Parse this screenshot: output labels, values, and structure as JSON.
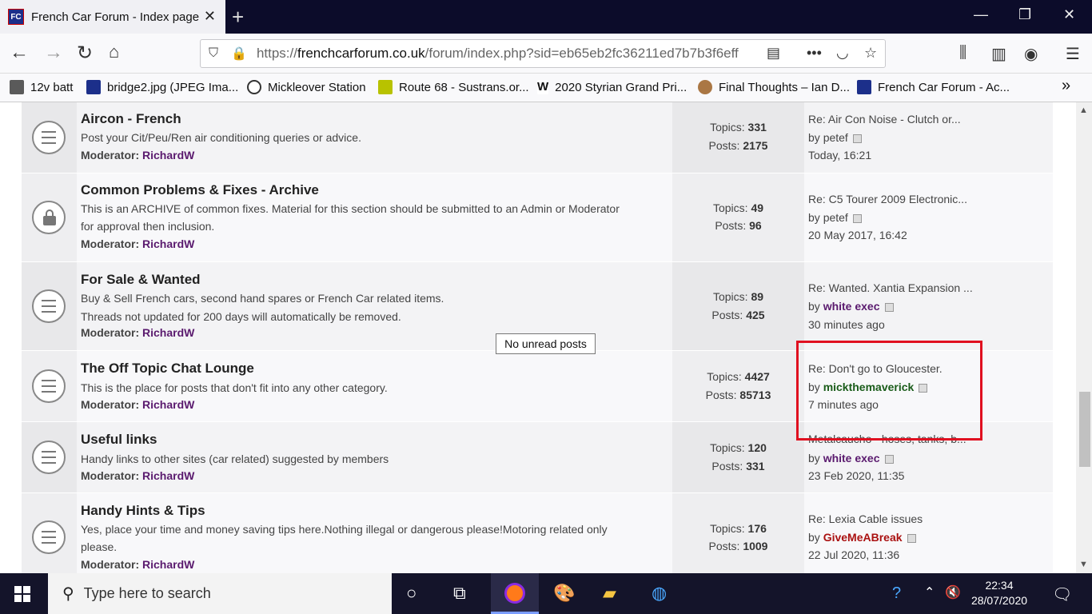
{
  "browser": {
    "tab_title": "French Car Forum - Index page",
    "tab_favicon_text": "FC",
    "url_domain": "frenchcarforum.co.uk",
    "url_prefix": "https://",
    "url_suffix": "/forum/index.php?sid=eb65eb2fc36211ed7b7b3f6eff",
    "bookmarks": [
      {
        "label": "12v batt",
        "color": "#5a5a5a"
      },
      {
        "label": "bridge2.jpg (JPEG Ima...",
        "color": "#1c2f8a"
      },
      {
        "label": "Mickleover Station",
        "color": "#333333"
      },
      {
        "label": "Route 68 - Sustrans.or...",
        "color": "#b8c200"
      },
      {
        "label": "2020 Styrian Grand Pri...",
        "color": "#ffffff"
      },
      {
        "label": "Final Thoughts – Ian D...",
        "color": "#aa7744"
      },
      {
        "label": "French Car Forum - Ac...",
        "color": "#1c2f8a"
      }
    ]
  },
  "forums": [
    {
      "title": "Aircon - French",
      "desc": [
        "Post your Cit/Peu/Ren air conditioning queries or advice."
      ],
      "moderator_label": "Moderator:",
      "moderator": "RichardW",
      "topics_label": "Topics:",
      "topics": "331",
      "posts_label": "Posts:",
      "posts": "2175",
      "last_subject": "Re: Air Con Noise - Clutch or...",
      "last_by": "by",
      "last_user": "petef",
      "last_user_color": "#444444",
      "last_time": "Today, 16:21"
    },
    {
      "title": "Common Problems & Fixes - Archive",
      "desc": [
        "This is an ARCHIVE of common fixes. Material for this section should be submitted to an Admin or Moderator",
        "for approval then inclusion."
      ],
      "moderator_label": "Moderator:",
      "moderator": "RichardW",
      "topics_label": "Topics:",
      "topics": "49",
      "posts_label": "Posts:",
      "posts": "96",
      "last_subject": "Re: C5 Tourer 2009 Electronic...",
      "last_by": "by",
      "last_user": "petef",
      "last_user_color": "#444444",
      "last_time": "20 May 2017, 16:42"
    },
    {
      "title": "For Sale & Wanted",
      "desc": [
        "Buy & Sell French cars, second hand spares or French Car related items.",
        "Threads not updated for 200 days will automatically be removed."
      ],
      "moderator_label": "Moderator:",
      "moderator": "RichardW",
      "topics_label": "Topics:",
      "topics": "89",
      "posts_label": "Posts:",
      "posts": "425",
      "last_subject": "Re: Wanted. Xantia Expansion ...",
      "last_by": "by",
      "last_user": "white exec",
      "last_user_color": "#5a1a6e",
      "last_time": "30 minutes ago"
    },
    {
      "title": "The Off Topic Chat Lounge",
      "desc": [
        "This is the place for posts that don't fit into any other category."
      ],
      "moderator_label": "Moderator:",
      "moderator": "RichardW",
      "topics_label": "Topics:",
      "topics": "4427",
      "posts_label": "Posts:",
      "posts": "85713",
      "last_subject": "Re: Don't go to Gloucester.",
      "last_by": "by",
      "last_user": "mickthemaverick",
      "last_user_color": "#1a5c1a",
      "last_time": "7 minutes ago"
    },
    {
      "title": "Useful links",
      "desc": [
        "Handy links to other sites (car related) suggested by members"
      ],
      "moderator_label": "Moderator:",
      "moderator": "RichardW",
      "topics_label": "Topics:",
      "topics": "120",
      "posts_label": "Posts:",
      "posts": "331",
      "last_subject": "Metalcaucho - hoses, tanks, b...",
      "last_by": "by",
      "last_user": "white exec",
      "last_user_color": "#5a1a6e",
      "last_time": "23 Feb 2020, 11:35"
    },
    {
      "title": "Handy Hints & Tips",
      "desc": [
        "Yes, place your time and money saving tips here.Nothing illegal or dangerous please!Motoring related only",
        "please."
      ],
      "moderator_label": "Moderator:",
      "moderator": "RichardW",
      "topics_label": "Topics:",
      "topics": "176",
      "posts_label": "Posts:",
      "posts": "1009",
      "last_subject": "Re: Lexia Cable issues",
      "last_by": "by",
      "last_user": "GiveMeABreak",
      "last_user_color": "#aa1111",
      "last_time": "22 Jul 2020, 11:36"
    }
  ],
  "tooltip": "No unread posts",
  "taskbar": {
    "search_placeholder": "Type here to search",
    "time": "22:34",
    "date": "28/07/2020"
  }
}
